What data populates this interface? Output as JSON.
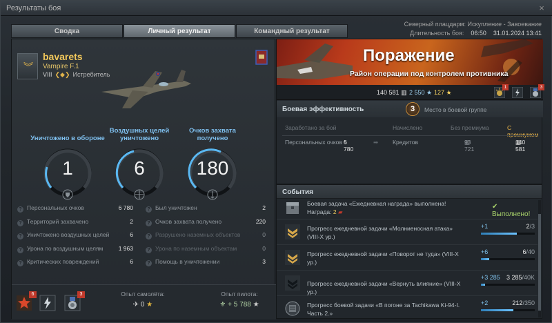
{
  "window": {
    "title": "Результаты боя",
    "close": "×"
  },
  "tabs": [
    {
      "label": "Сводка",
      "active": false
    },
    {
      "label": "Личный результат",
      "active": true
    },
    {
      "label": "Командный результат",
      "active": false
    }
  ],
  "map": {
    "name": "Северный плацдарм: Искупление - Завоевание",
    "duration_label": "Длительность боя:",
    "duration": "06:50",
    "datetime": "31.01.2024 13:41"
  },
  "player": {
    "name": "bavarets",
    "plane": "Vampire F.1",
    "tier": "VIII",
    "class": "Истребитель"
  },
  "stats_big": [
    {
      "label": "Уничтожено в обороне",
      "value": "1",
      "icon": "shield-icon"
    },
    {
      "label": "Воздушных целей уничтожено",
      "value": "6",
      "icon": "crosshair-icon"
    },
    {
      "label": "Очков захвата получено",
      "value": "180",
      "icon": "capture-icon"
    }
  ],
  "stats_table": {
    "left": [
      {
        "label": "Персональных очков",
        "value": "6 780",
        "dim": false
      },
      {
        "label": "Территорий захвачено",
        "value": "2",
        "dim": false
      },
      {
        "label": "Уничтожено воздушных целей",
        "value": "6",
        "dim": false
      },
      {
        "label": "Урона по воздушным целям",
        "value": "1 963",
        "dim": false
      },
      {
        "label": "Критических повреждений",
        "value": "6",
        "dim": false
      }
    ],
    "right": [
      {
        "label": "Был уничтожен",
        "value": "2",
        "dim": false
      },
      {
        "label": "Очков захвата получено",
        "value": "220",
        "dim": false
      },
      {
        "label": "Разрушено наземных объектов",
        "value": "0",
        "dim": true
      },
      {
        "label": "Урона по наземным объектам",
        "value": "0",
        "dim": true
      },
      {
        "label": "Помощь в уничтожении",
        "value": "3",
        "dim": false
      }
    ]
  },
  "footer": {
    "medals": [
      {
        "icon": "star-medal-icon",
        "count": "6"
      },
      {
        "icon": "lightning-medal-icon",
        "count": ""
      },
      {
        "icon": "order-medal-icon",
        "count": "3"
      }
    ],
    "plane_xp_label": "Опыт самолёта:",
    "plane_xp_value": "0",
    "pilot_xp_label": "Опыт пилота:",
    "pilot_xp_value": "+ 5 788"
  },
  "result": {
    "title": "Поражение",
    "subtitle": "Район операции под контролем противника",
    "credits": "140 581",
    "free_xp": "2 550",
    "gold": "127",
    "badges": [
      {
        "icon": "bomb-medal-icon",
        "count": "1"
      },
      {
        "icon": "lightning-medal-icon",
        "count": ""
      },
      {
        "icon": "order-medal-icon",
        "count": "3"
      }
    ]
  },
  "efficiency": {
    "title": "Боевая эффективность",
    "place": "3",
    "place_label": "Место в боевой группе",
    "cols": {
      "earned": "Заработано за бой",
      "accrued": "Начислено",
      "no_premium": "Без премиума",
      "with_premium": "С премиумом"
    },
    "row": {
      "label": "Персональных очков",
      "value": "6 780",
      "currency": "Кредитов",
      "no_premium": "93 721",
      "with_premium": "140 581"
    }
  },
  "events": {
    "title": "События",
    "items": [
      {
        "text": "Боевая задача «Ежедневная награда» выполнена!",
        "text2_label": "Награда:",
        "text2_value": "2",
        "done": "✔ Выполнено!",
        "icon": "chest-icon",
        "completed": true
      },
      {
        "text": "Прогресс ежедневной задачи «Молниеносная атака» (VIII-X ур.)",
        "delta": "+1",
        "current": "2",
        "total": "3",
        "progress": 0.667,
        "icon": "chevron-rank-icon"
      },
      {
        "text": "Прогресс ежедневной задачи «Поворот не туда» (VIII-X ур.)",
        "delta": "+6",
        "current": "6",
        "total": "40",
        "progress": 0.15,
        "icon": "chevron-rank-icon"
      },
      {
        "text": "Прогресс ежедневной задачи «Вернуть влияние» (VIII-X ур.)",
        "delta": "+3 285",
        "current": "3 285",
        "total": "40K",
        "progress": 0.082,
        "icon": "chevron-dark-icon"
      },
      {
        "text": "Прогресс боевой задачи «В погоне за Tachikawa Ki-94-I. Часть 2.»",
        "delta": "+2",
        "current": "212",
        "total": "350",
        "progress": 0.606,
        "icon": "mission-icon"
      }
    ]
  }
}
